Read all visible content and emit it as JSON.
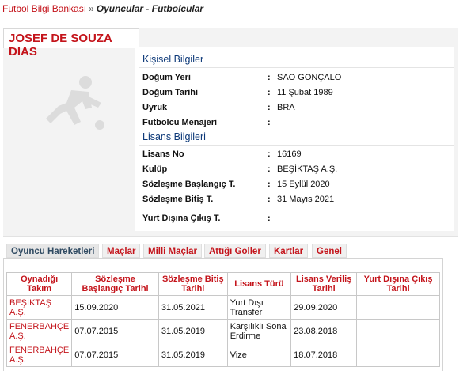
{
  "breadcrumb": {
    "home": "Futbol Bilgi Bankası",
    "separator": "»",
    "current": "Oyuncular - Futbolcular"
  },
  "player": {
    "name": "JOSEF DE SOUZA DIAS"
  },
  "personal": {
    "title": "Kişisel Bilgiler",
    "rows": [
      {
        "label": "Doğum Yeri",
        "value": "SAO GONÇALO"
      },
      {
        "label": "Doğum Tarihi",
        "value": "11 Şubat 1989"
      },
      {
        "label": "Uyruk",
        "value": "BRA"
      },
      {
        "label": "Futbolcu Menajeri",
        "value": ""
      }
    ]
  },
  "license": {
    "title": "Lisans Bilgileri",
    "rows": [
      {
        "label": "Lisans No",
        "value": "16169"
      },
      {
        "label": "Kulüp",
        "value": "BEŞİKTAŞ A.Ş."
      },
      {
        "label": "Sözleşme Başlangıç T.",
        "value": "15 Eylül 2020"
      },
      {
        "label": "Sözleşme Bitiş T.",
        "value": "31 Mayıs 2021"
      },
      {
        "label": "Yurt Dışına Çıkış T.",
        "value": ""
      }
    ]
  },
  "colon": ":",
  "tabs": [
    "Oyuncu Hareketleri",
    "Maçlar",
    "Milli Maçlar",
    "Attığı Goller",
    "Kartlar",
    "Genel"
  ],
  "table": {
    "headers": [
      "Oynadığı Takım",
      "Sözleşme Başlangıç Tarihi",
      "Sözleşme Bitiş Tarihi",
      "Lisans Türü",
      "Lisans Veriliş Tarihi",
      "Yurt Dışına Çıkış Tarihi"
    ],
    "rows": [
      [
        "BEŞİKTAŞ A.Ş.",
        "15.09.2020",
        "31.05.2021",
        "Yurt Dışı Transfer",
        "29.09.2020",
        ""
      ],
      [
        "FENERBAHÇE A.Ş.",
        "07.07.2015",
        "31.05.2019",
        "Karşılıklı Sona Erdirme",
        "23.08.2018",
        ""
      ],
      [
        "FENERBAHÇE A.Ş.",
        "07.07.2015",
        "31.05.2019",
        "Vize",
        "18.07.2018",
        ""
      ]
    ]
  }
}
